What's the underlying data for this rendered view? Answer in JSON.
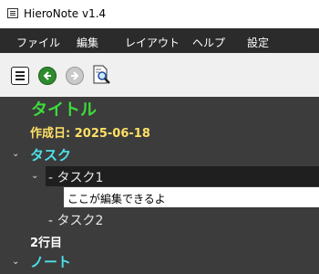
{
  "window": {
    "title": "HieroNote v1.4"
  },
  "menubar": {
    "items": [
      "ファイル",
      "編集",
      "レイアウト",
      "ヘルプ",
      "設定"
    ]
  },
  "toolbar": {
    "buttons": [
      {
        "icon": "list-icon"
      },
      {
        "icon": "back-arrow-icon"
      },
      {
        "icon": "forward-arrow-icon"
      },
      {
        "icon": "search-document-icon"
      }
    ]
  },
  "document": {
    "title": "タイトル",
    "created_date": "作成日: 2025-06-18",
    "section_task": "タスク",
    "task1": "- タスク1",
    "task1_edit_value": "ここが編集できるよ",
    "task2": "- タスク2",
    "line2": "2行目",
    "section_note": "ノート"
  },
  "colors": {
    "title_green": "#3cdc3c",
    "date_yellow": "#ffe066",
    "section_cyan": "#4de0e8",
    "editor_bg": "#3c3c3c",
    "menubar_bg": "#2b2b2b"
  }
}
